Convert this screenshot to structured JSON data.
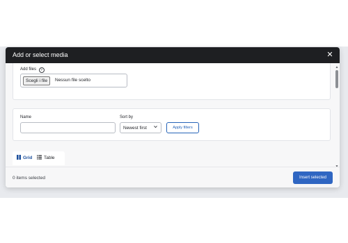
{
  "dialog": {
    "title": "Add or select media",
    "close_symbol": "✕"
  },
  "upload": {
    "label": "Add files",
    "help_symbol": "?",
    "file_button": "Scegli i file",
    "file_status": "Nessun file scelto"
  },
  "filters": {
    "name_label": "Name",
    "name_value": "",
    "sort_label": "Sort by",
    "sort_value": "Newest first",
    "apply_label": "Apply filters"
  },
  "view_tabs": {
    "grid_label": "Grid",
    "table_label": "Table",
    "active": "Grid"
  },
  "footer": {
    "selected_text": "0 items selected",
    "insert_label": "Insert selected"
  },
  "colors": {
    "header_bg": "#1e1f22",
    "accent": "#2f66c2",
    "link": "#2563b8"
  },
  "icons": {
    "close": "close-icon",
    "help": "help-icon",
    "sort_chevron": "chevron-down-icon",
    "grid": "grid-icon",
    "table": "table-icon"
  }
}
